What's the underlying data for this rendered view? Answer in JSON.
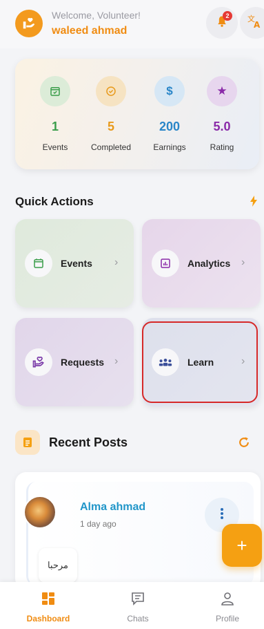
{
  "header": {
    "welcome": "Welcome, Volunteer!",
    "username": "waleed ahmad",
    "notification_count": "2",
    "logo_icon": "hand-heart-icon",
    "bell_icon": "bell-icon",
    "translate_icon": "translate-icon"
  },
  "stats": [
    {
      "value": "1",
      "label": "Events",
      "icon": "calendar-check-icon",
      "color": "#3a9d4a",
      "bg": "#dcecd8"
    },
    {
      "value": "5",
      "label": "Completed",
      "icon": "check-circle-icon",
      "color": "#e89a1c",
      "bg": "#f6e3c2"
    },
    {
      "value": "200",
      "label": "Earnings",
      "icon": "dollar-icon",
      "color": "#2a86c8",
      "bg": "#d6e7f5"
    },
    {
      "value": "5.0",
      "label": "Rating",
      "icon": "star-icon",
      "color": "#8a2aa8",
      "bg": "#e7d6ee"
    }
  ],
  "quick_actions": {
    "title": "Quick Actions",
    "items": [
      {
        "label": "Events",
        "icon": "calendar-icon"
      },
      {
        "label": "Analytics",
        "icon": "bar-chart-icon"
      },
      {
        "label": "Requests",
        "icon": "hand-heart-icon"
      },
      {
        "label": "Learn",
        "icon": "group-icon"
      }
    ]
  },
  "recent_posts": {
    "title": "Recent Posts",
    "posts": [
      {
        "author": "Alma ahmad",
        "time": "1 day ago",
        "text": "مرحبا"
      }
    ]
  },
  "fab": {
    "label": "+"
  },
  "bottom_nav": [
    {
      "label": "Dashboard",
      "active": true,
      "icon": "dashboard-icon"
    },
    {
      "label": "Chats",
      "active": false,
      "icon": "chat-icon"
    },
    {
      "label": "Profile",
      "active": false,
      "icon": "profile-icon"
    }
  ],
  "colors": {
    "accent": "#f08c12",
    "link": "#2196c9",
    "highlight": "#d62828"
  }
}
